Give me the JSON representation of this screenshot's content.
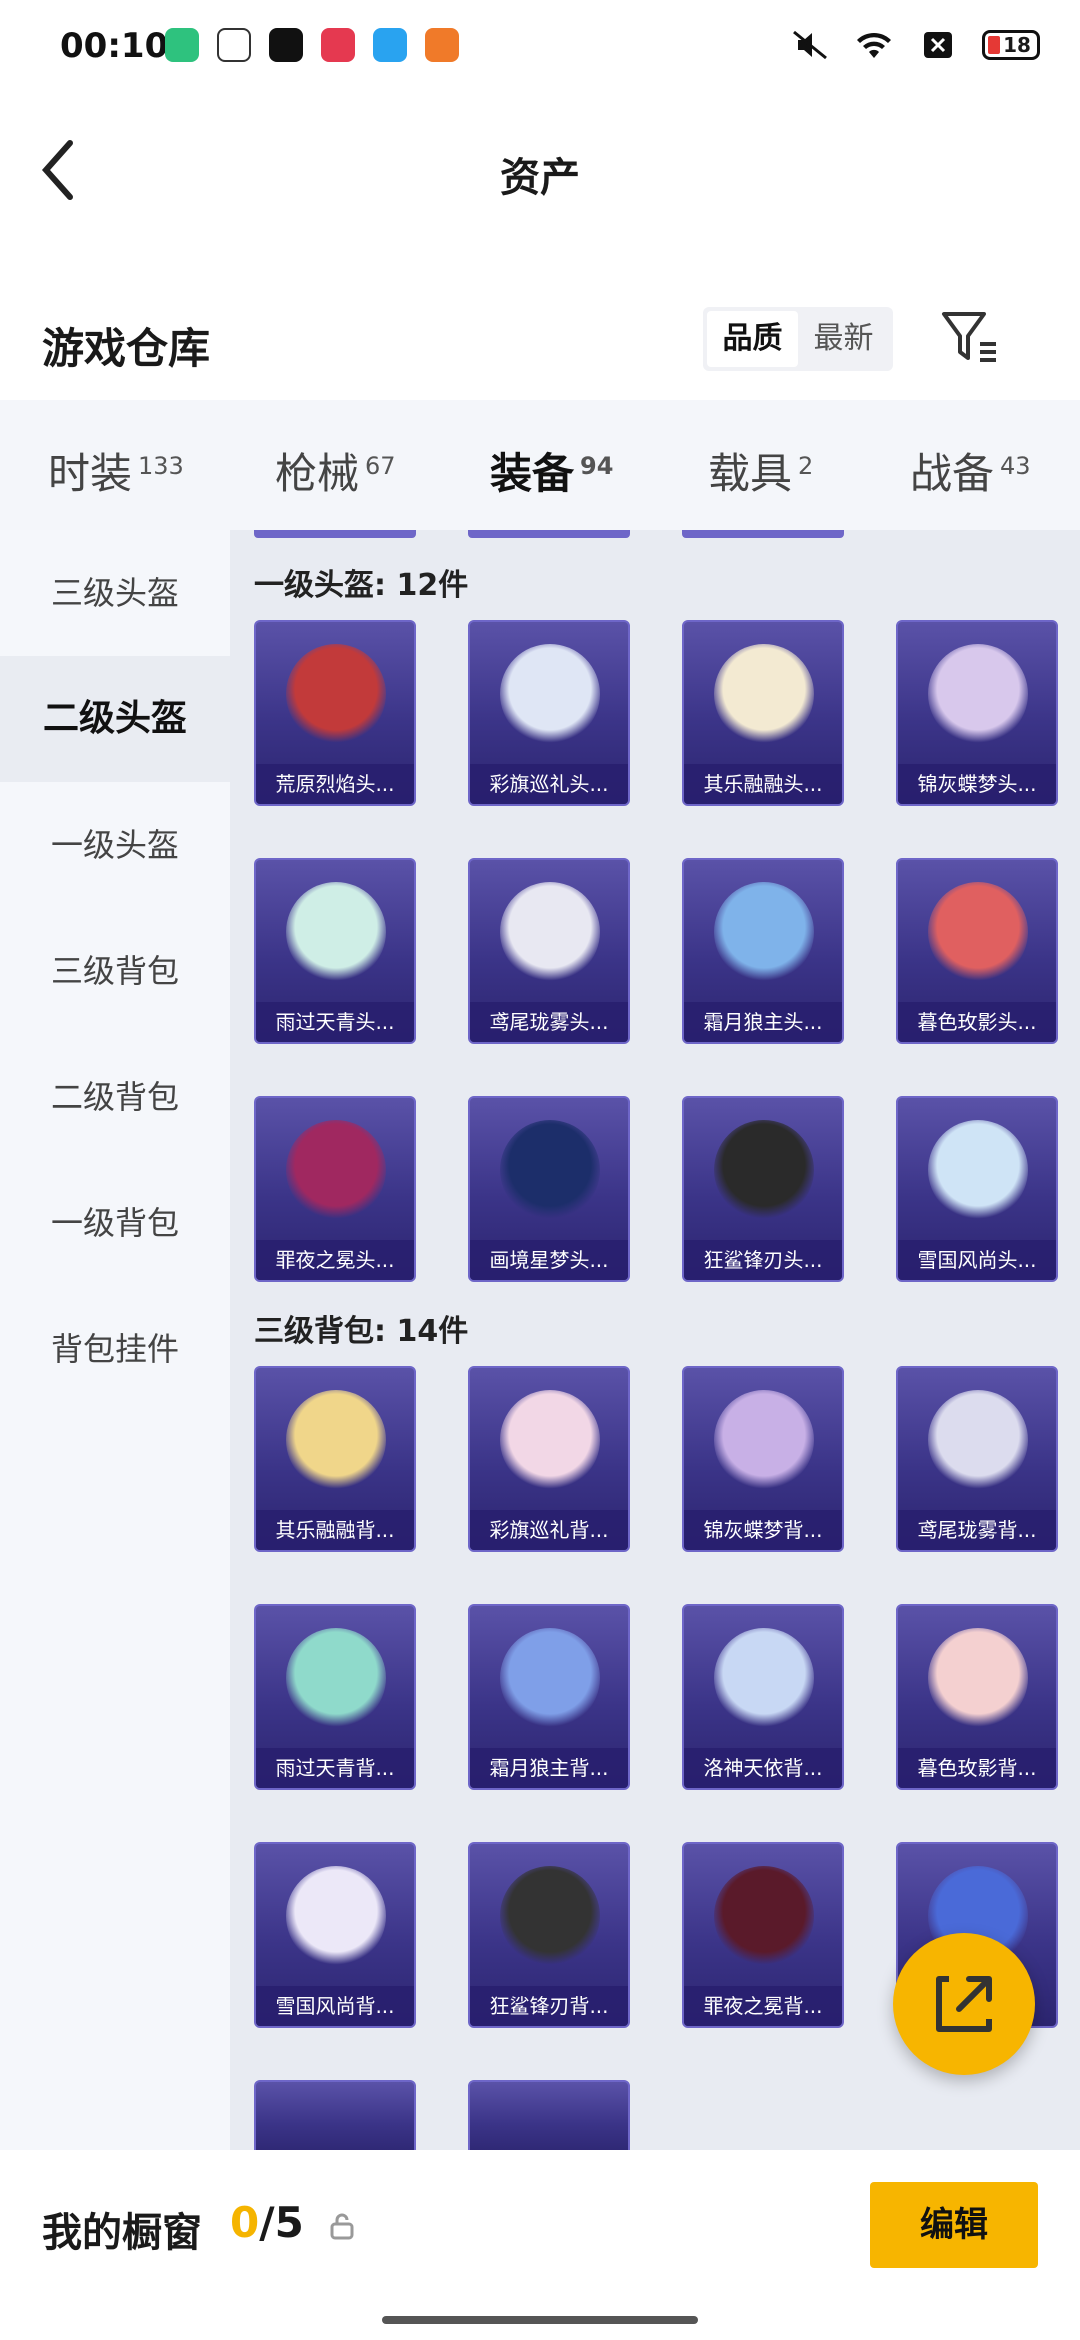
{
  "status_bar": {
    "time": "00:10",
    "battery": "18"
  },
  "header": {
    "title": "资产"
  },
  "warehouse": {
    "title": "游戏仓库",
    "sort_options": [
      "品质",
      "最新"
    ]
  },
  "tabs": [
    {
      "label": "时装",
      "count": "133"
    },
    {
      "label": "枪械",
      "count": "67"
    },
    {
      "label": "装备",
      "count": "94"
    },
    {
      "label": "载具",
      "count": "2"
    },
    {
      "label": "战备",
      "count": "43"
    }
  ],
  "sidebar": [
    "三级头盔",
    "二级头盔",
    "一级头盔",
    "三级背包",
    "二级背包",
    "一级背包",
    "背包挂件"
  ],
  "groups": [
    {
      "title": "一级头盔: 12件",
      "items": [
        "荒原烈焰头...",
        "彩旗巡礼头...",
        "其乐融融头...",
        "锦灰蝶梦头...",
        "雨过天青头...",
        "鸢尾珑雾头...",
        "霜月狼主头...",
        "暮色玫影头...",
        "罪夜之冕头...",
        "画境星梦头...",
        "狂鲨锋刃头...",
        "雪国风尚头..."
      ]
    },
    {
      "title": "三级背包: 14件",
      "items": [
        "其乐融融背...",
        "彩旗巡礼背...",
        "锦灰蝶梦背...",
        "鸢尾珑雾背...",
        "雨过天青背...",
        "霜月狼主背...",
        "洛神天依背...",
        "暮色玫影背...",
        "雪国风尚背...",
        "狂鲨锋刃背...",
        "罪夜之冕背...",
        ""
      ]
    }
  ],
  "bottom": {
    "label": "我的橱窗",
    "count_current": "0",
    "count_total": "/5",
    "edit_label": "编辑"
  },
  "colors": {
    "accent": "#f7b500",
    "card_bg": "#3b3488"
  }
}
